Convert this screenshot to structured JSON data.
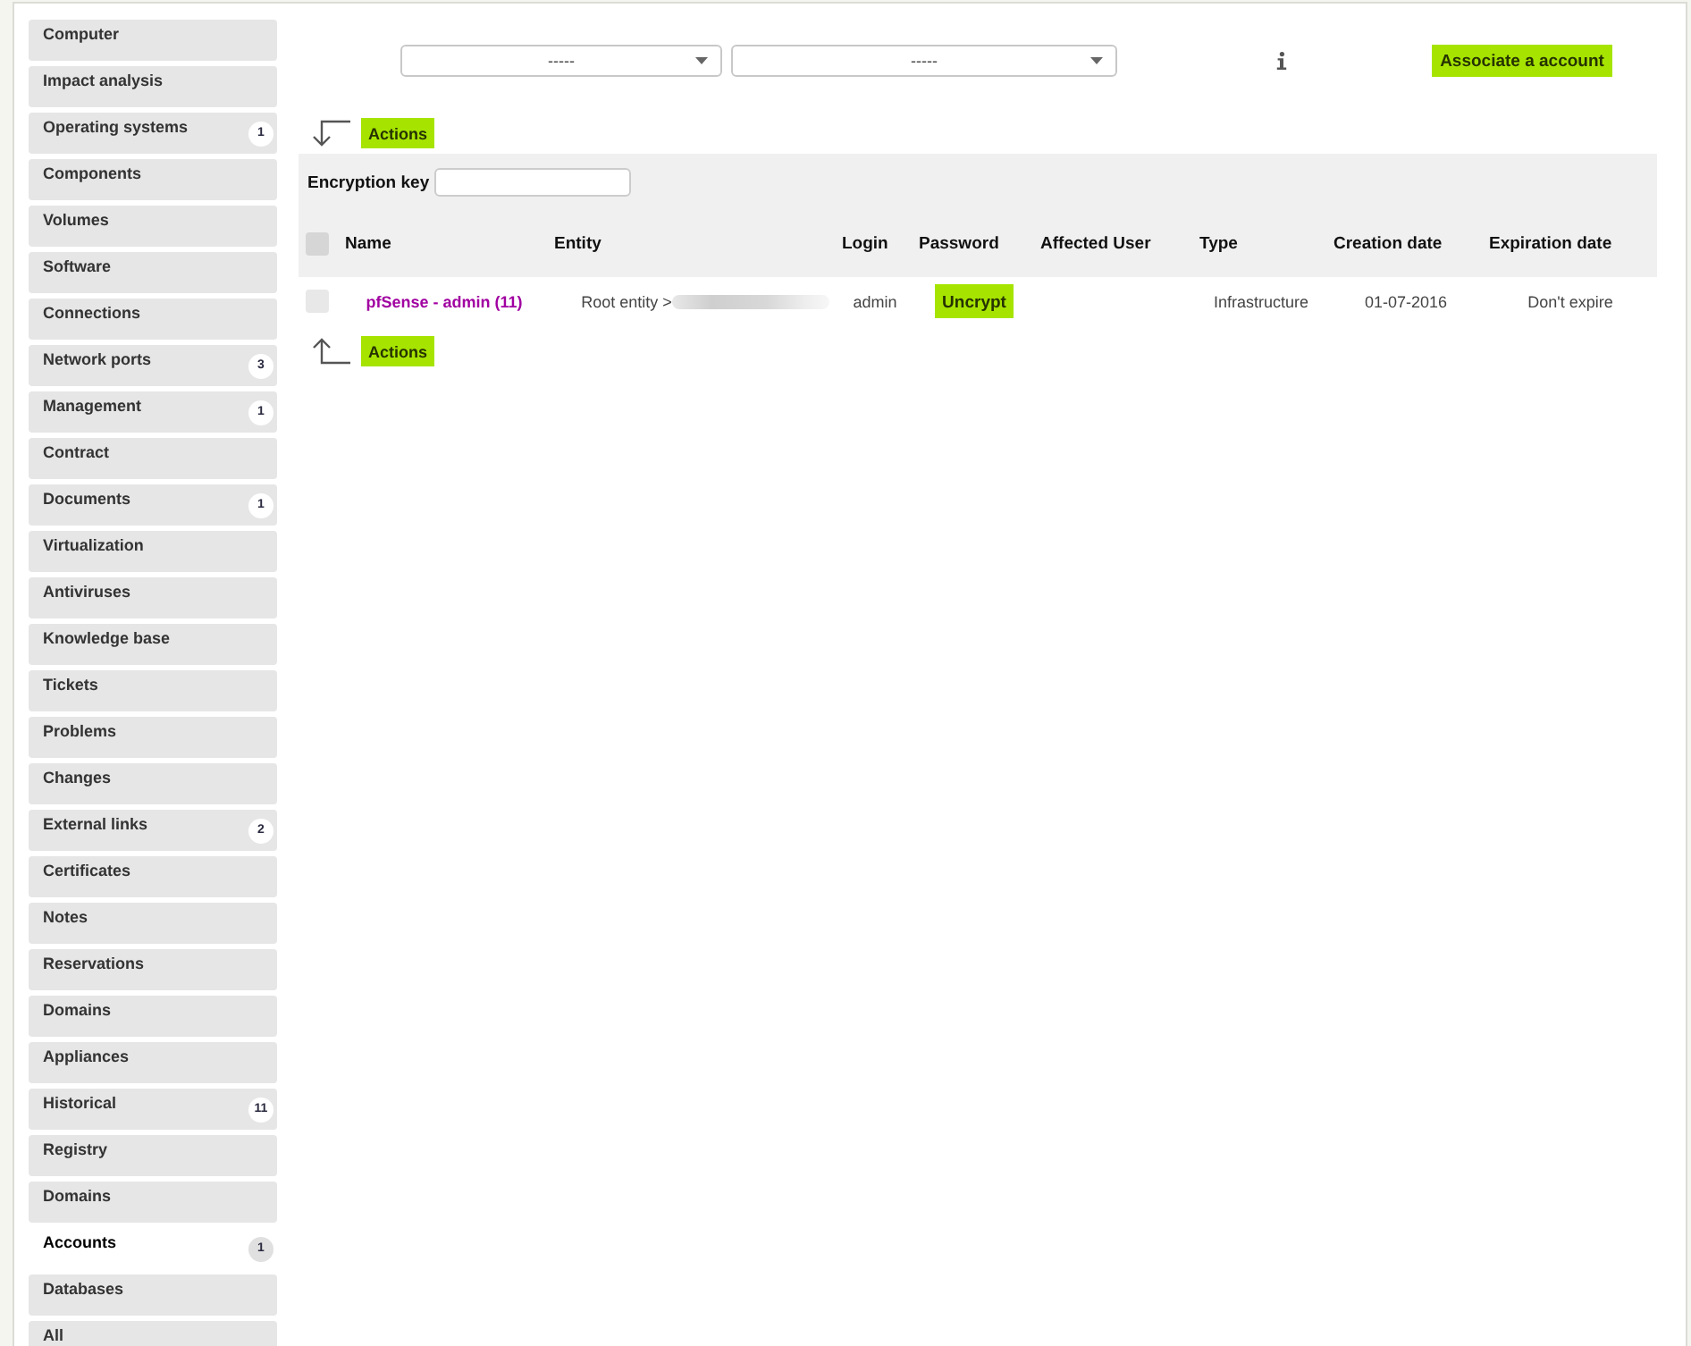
{
  "sidebar": {
    "items": [
      {
        "label": "Computer",
        "selected": false
      },
      {
        "label": "Impact analysis",
        "selected": false
      },
      {
        "label": "Operating systems",
        "badge": "1",
        "selected": false
      },
      {
        "label": "Components",
        "selected": false
      },
      {
        "label": "Volumes",
        "selected": false
      },
      {
        "label": "Software",
        "selected": false
      },
      {
        "label": "Connections",
        "selected": false
      },
      {
        "label": "Network ports",
        "badge": "3",
        "selected": false
      },
      {
        "label": "Management",
        "badge": "1",
        "selected": false
      },
      {
        "label": "Contract",
        "selected": false
      },
      {
        "label": "Documents",
        "badge": "1",
        "selected": false
      },
      {
        "label": "Virtualization",
        "selected": false
      },
      {
        "label": "Antiviruses",
        "selected": false
      },
      {
        "label": "Knowledge base",
        "selected": false
      },
      {
        "label": "Tickets",
        "selected": false
      },
      {
        "label": "Problems",
        "selected": false
      },
      {
        "label": "Changes",
        "selected": false
      },
      {
        "label": "External links",
        "badge": "2",
        "selected": false
      },
      {
        "label": "Certificates",
        "selected": false
      },
      {
        "label": "Notes",
        "selected": false
      },
      {
        "label": "Reservations",
        "selected": false
      },
      {
        "label": "Domains",
        "selected": false
      },
      {
        "label": "Appliances",
        "selected": false
      },
      {
        "label": "Historical",
        "badge": "11",
        "selected": false
      },
      {
        "label": "Registry",
        "selected": false
      },
      {
        "label": "Domains",
        "selected": false
      },
      {
        "label": "Accounts",
        "badge": "1",
        "selected": true
      },
      {
        "label": "Databases",
        "selected": false
      },
      {
        "label": "All",
        "selected": false
      }
    ]
  },
  "toolbar": {
    "selects": [
      {
        "value": "-----"
      },
      {
        "value": "-----"
      }
    ],
    "button": "Associate a account"
  },
  "actions_top": {
    "label": "Actions"
  },
  "encryption_key": {
    "label": "Encryption key"
  },
  "table": {
    "select_all": {
      "checked": false
    },
    "columns": [
      "Name",
      "Entity",
      "Login",
      "Password",
      "Affected User",
      "Type",
      "Creation date",
      "Expiration date"
    ],
    "rows": [
      {
        "checked": false,
        "name": "pfSense - admin (11)",
        "entity": "Root entity >",
        "entity_blurred": true,
        "login": "admin",
        "password_button": "Uncrypt",
        "type": "Infrastructure",
        "creation_date": "01-07-2016",
        "expiration_date": "Don't expire"
      }
    ]
  },
  "actions_bottom": {
    "label": "Actions"
  }
}
